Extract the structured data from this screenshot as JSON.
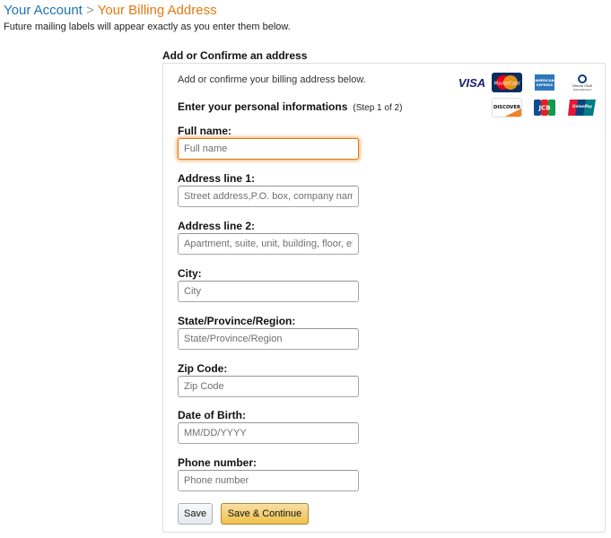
{
  "breadcrumb": {
    "parent": "Your Account",
    "separator": ">",
    "current": "Your Billing Address"
  },
  "subtitle": "Future mailing labels will appear exactly as you enter them below.",
  "section_title": "Add or Confirme an address",
  "form": {
    "intro": "Add or confirme your billing address below.",
    "step_title": "Enter your personal informations",
    "step_indicator": "(Step 1 of 2)",
    "fields": [
      {
        "label": "Full name:",
        "placeholder": "Full name",
        "value": "",
        "focused": true
      },
      {
        "label": "Address line 1:",
        "placeholder": "Street address,P.O. box, company name,",
        "value": ""
      },
      {
        "label": "Address line 2:",
        "placeholder": "Apartment, suite, unit, building, floor, etc.",
        "value": ""
      },
      {
        "label": "City:",
        "placeholder": "City",
        "value": ""
      },
      {
        "label": "State/Province/Region:",
        "placeholder": "State/Province/Region",
        "value": ""
      },
      {
        "label": "Zip Code:",
        "placeholder": "Zip Code",
        "value": ""
      },
      {
        "label": "Date of Birth:",
        "placeholder": "MM/DD/YYYY",
        "value": ""
      },
      {
        "label": "Phone number:",
        "placeholder": "Phone number",
        "value": ""
      }
    ],
    "buttons": {
      "save": "Save",
      "continue": "Save & Continue"
    }
  },
  "card_logos": {
    "visa": "VISA",
    "mastercard": "MasterCard",
    "amex": "AMERICAN EXPRESS",
    "diners": "Diners Club International",
    "discover": "DISCOVER",
    "jcb": "JCB",
    "unionpay": "UnionPay"
  },
  "colors": {
    "link": "#1a73b8",
    "accent": "#e47911",
    "button_primary": "#f0c14b"
  }
}
